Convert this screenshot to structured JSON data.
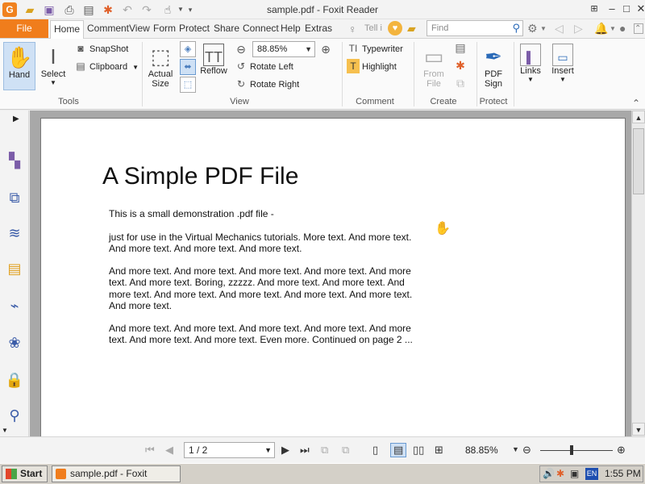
{
  "window": {
    "title": "sample.pdf - Foxit Reader"
  },
  "menu": {
    "file": "File",
    "tabs": [
      "Home",
      "Comment",
      "View",
      "Form",
      "Protect",
      "Share",
      "Connect",
      "Help",
      "Extras"
    ],
    "tell_me": "Tell i",
    "find_placeholder": "Find"
  },
  "ribbon": {
    "tools": {
      "hand": "Hand",
      "select": "Select",
      "snapshot": "SnapShot",
      "clipboard": "Clipboard",
      "label": "Tools"
    },
    "view": {
      "actual_size_1": "Actual",
      "actual_size_2": "Size",
      "reflow": "Reflow",
      "zoom": "88.85%",
      "rotate_left": "Rotate Left",
      "rotate_right": "Rotate Right",
      "label": "View"
    },
    "comment": {
      "typewriter": "Typewriter",
      "highlight": "Highlight",
      "label": "Comment"
    },
    "create": {
      "from_file_1": "From",
      "from_file_2": "File",
      "label": "Create"
    },
    "protect": {
      "pdf_sign_1": "PDF",
      "pdf_sign_2": "Sign",
      "label": "Protect"
    },
    "links": "Links",
    "insert": "Insert"
  },
  "document": {
    "title": "A Simple PDF File",
    "paragraphs": [
      "This is a small demonstration .pdf file -",
      "just for use in the Virtual Mechanics tutorials. More text. And more text. And more text. And more text. And more text.",
      "And more text. And more text. And more text. And more text. And more text. And more text. Boring, zzzzz. And more text. And more text. And more text. And more text. And more text. And more text. And more text. And more text.",
      "And more text. And more text. And more text. And more text. And more text. And more text. And more text. Even more. Continued on page 2 ..."
    ]
  },
  "status": {
    "page": "1 / 2",
    "zoom": "88.85%"
  },
  "taskbar": {
    "start": "Start",
    "task": "sample.pdf - Foxit Reader",
    "lang": "EN",
    "time": "1:55 PM"
  }
}
